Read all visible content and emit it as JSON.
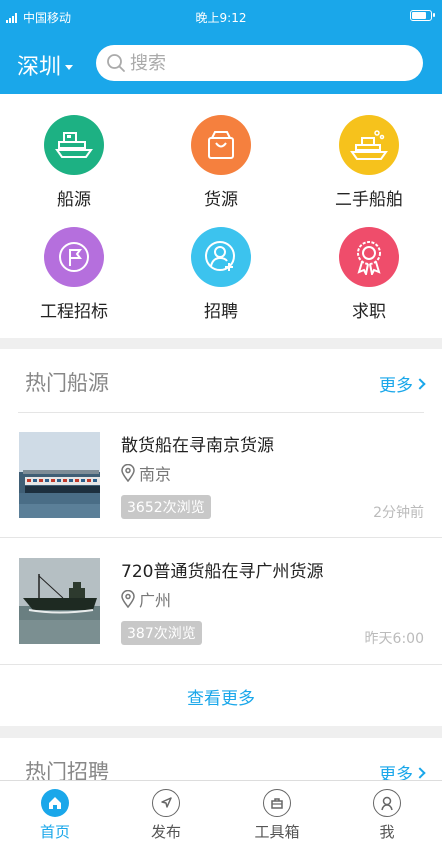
{
  "status": {
    "carrier": "中国移动",
    "time": "晚上9:12"
  },
  "header": {
    "city": "深圳",
    "search_placeholder": "搜索"
  },
  "categories": [
    {
      "label": "船源",
      "icon": "ship-icon",
      "color": "#1db183"
    },
    {
      "label": "货源",
      "icon": "shopping-bag-icon",
      "color": "#f5803e"
    },
    {
      "label": "二手船舶",
      "icon": "used-ship-icon",
      "color": "#f6c21c"
    },
    {
      "label": "工程招标",
      "icon": "flag-icon",
      "color": "#b56fdd"
    },
    {
      "label": "招聘",
      "icon": "add-user-icon",
      "color": "#3cc3ee"
    },
    {
      "label": "求职",
      "icon": "award-icon",
      "color": "#ef4d6b"
    }
  ],
  "hot_ships": {
    "title": "热门船源",
    "more_label": "更多",
    "items": [
      {
        "title": "散货船在寻南京货源",
        "location": "南京",
        "views": "3652次浏览",
        "time": "2分钟前"
      },
      {
        "title": "720普通货船在寻广州货源",
        "location": "广州",
        "views": "387次浏览",
        "time": "昨天6:00"
      }
    ],
    "view_more_label": "查看更多"
  },
  "hot_jobs": {
    "title": "热门招聘",
    "more_label": "更多"
  },
  "tabbar": [
    {
      "label": "首页",
      "icon": "home-icon",
      "active": true
    },
    {
      "label": "发布",
      "icon": "navigation-icon",
      "active": false
    },
    {
      "label": "工具箱",
      "icon": "toolbox-icon",
      "active": false
    },
    {
      "label": "我",
      "icon": "user-icon",
      "active": false
    }
  ],
  "colors": {
    "accent": "#1aa7ea"
  }
}
